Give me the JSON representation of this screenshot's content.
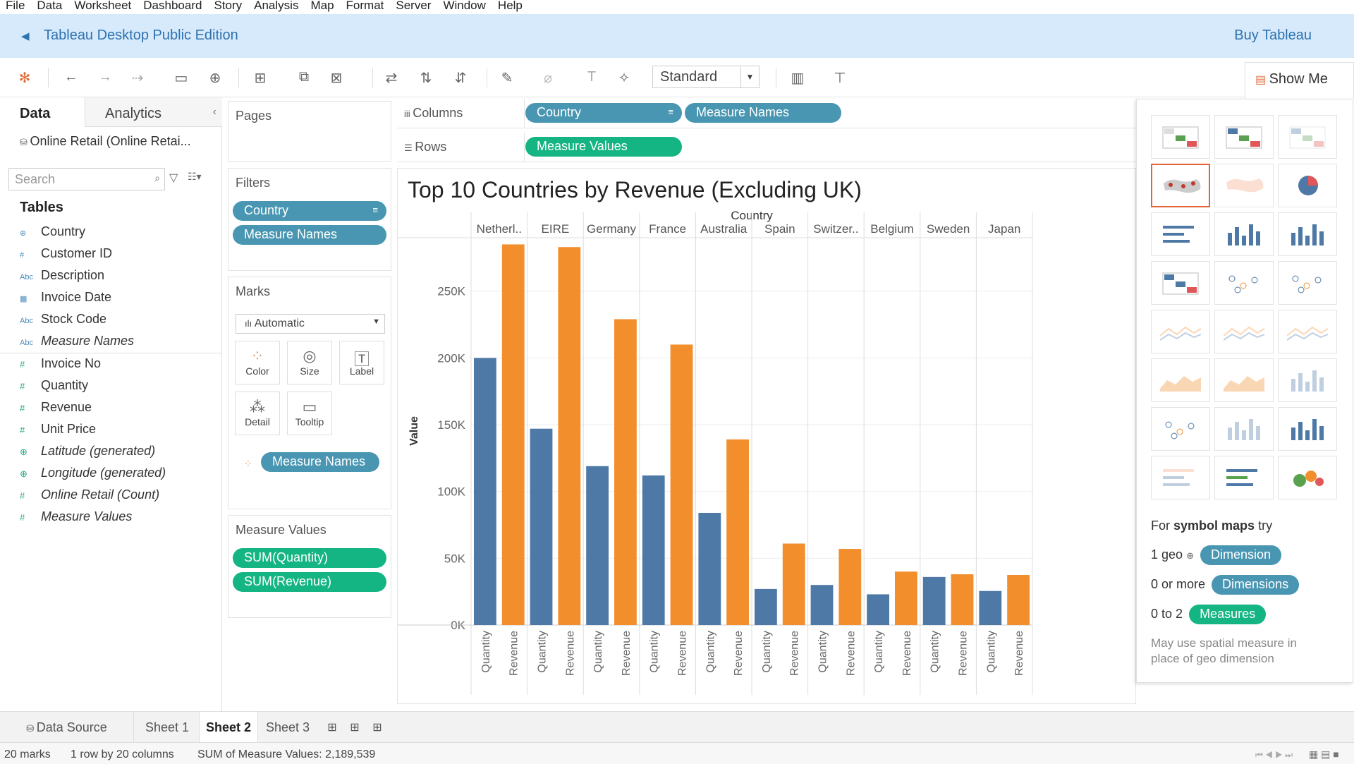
{
  "menu": [
    "File",
    "Data",
    "Worksheet",
    "Dashboard",
    "Story",
    "Analysis",
    "Map",
    "Format",
    "Server",
    "Window",
    "Help"
  ],
  "banner": {
    "title": "Tableau Desktop Public Edition",
    "buy": "Buy Tableau"
  },
  "toolbar": {
    "view_size": "Standard"
  },
  "data_pane": {
    "tab_data": "Data",
    "tab_analytics": "Analytics",
    "source": "Online Retail (Online Retai...",
    "search_placeholder": "Search",
    "tables_heading": "Tables",
    "dimensions": [
      {
        "name": "Country",
        "icon": "globe-icon"
      },
      {
        "name": "Customer ID",
        "icon": "hash-icon"
      },
      {
        "name": "Description",
        "icon": "abc-icon"
      },
      {
        "name": "Invoice Date",
        "icon": "calendar-icon"
      },
      {
        "name": "Stock Code",
        "icon": "abc-icon"
      },
      {
        "name": "Measure Names",
        "icon": "abc-icon"
      }
    ],
    "measures": [
      {
        "name": "Invoice No",
        "icon": "hash-icon"
      },
      {
        "name": "Quantity",
        "icon": "hash-icon"
      },
      {
        "name": "Revenue",
        "icon": "hash-icon"
      },
      {
        "name": "Unit Price",
        "icon": "hash-icon"
      },
      {
        "name": "Latitude (generated)",
        "icon": "globe-icon"
      },
      {
        "name": "Longitude (generated)",
        "icon": "globe-icon"
      },
      {
        "name": "Online Retail (Count)",
        "icon": "hash-icon"
      },
      {
        "name": "Measure Values",
        "icon": "hash-icon"
      }
    ]
  },
  "cards": {
    "pages": "Pages",
    "filters": "Filters",
    "filter_pills": [
      "Country",
      "Measure Names"
    ],
    "marks": "Marks",
    "mark_type": "Automatic",
    "mark_buttons": [
      "Color",
      "Size",
      "Label",
      "Detail",
      "Tooltip"
    ],
    "color_pill": "Measure Names",
    "measure_values": "Measure Values",
    "measure_pills": [
      "SUM(Quantity)",
      "SUM(Revenue)"
    ]
  },
  "shelves": {
    "columns_label": "Columns",
    "columns": [
      "Country",
      "Measure Names"
    ],
    "rows_label": "Rows",
    "rows": [
      "Measure Values"
    ]
  },
  "chart_data": {
    "type": "bar",
    "title": "Top 10 Countries by Revenue (Excluding UK)",
    "header": "Country",
    "ylabel": "Value",
    "ylim": [
      0,
      290000
    ],
    "yticks": [
      0,
      50000,
      100000,
      150000,
      200000,
      250000
    ],
    "ytick_labels": [
      "0K",
      "50K",
      "100K",
      "150K",
      "200K",
      "250K"
    ],
    "categories": [
      "Netherl..",
      "EIRE",
      "Germany",
      "France",
      "Australia",
      "Spain",
      "Switzer..",
      "Belgium",
      "Sweden",
      "Japan"
    ],
    "series": [
      {
        "name": "Quantity",
        "color": "#4e79a7",
        "values": [
          200000,
          147000,
          119000,
          112000,
          84000,
          27000,
          30000,
          23000,
          36000,
          25500
        ]
      },
      {
        "name": "Revenue",
        "color": "#f28e2b",
        "values": [
          285000,
          283000,
          229000,
          210000,
          139000,
          61000,
          57000,
          40000,
          38000,
          37500
        ]
      }
    ],
    "grid": true
  },
  "show_me": {
    "tab_label": "Show Me",
    "hint_prefix": "For",
    "hint_bold": "symbol maps",
    "hint_suffix": "try",
    "req1_prefix": "1 geo",
    "req1_pill": "Dimension",
    "req2_prefix": "0 or more",
    "req2_pill": "Dimensions",
    "req3_prefix": "0 to 2",
    "req3_pill": "Measures",
    "note": "May use spatial measure in place of geo dimension"
  },
  "sheet_tabs": {
    "data_source": "Data Source",
    "sheets": [
      "Sheet 1",
      "Sheet 2",
      "Sheet 3"
    ],
    "active": "Sheet 2"
  },
  "status": {
    "marks": "20 marks",
    "dims": "1 row by 20 columns",
    "sum": "SUM of Measure Values: 2,189,539"
  }
}
